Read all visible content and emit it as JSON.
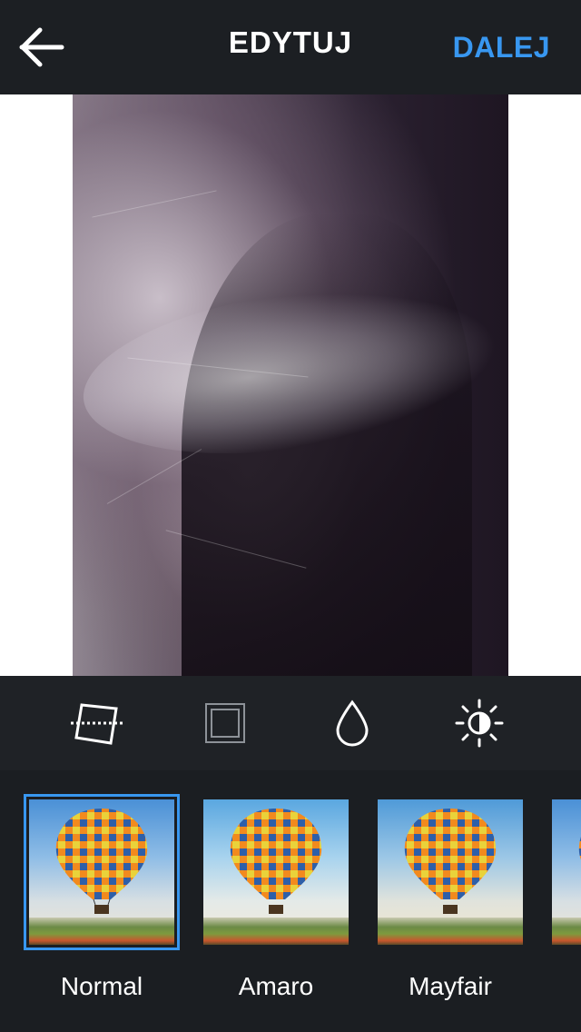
{
  "header": {
    "title": "EDYTUJ",
    "next_label": "DALEJ",
    "back_icon": "arrow-left-icon"
  },
  "tools": [
    {
      "name": "straighten-icon"
    },
    {
      "name": "frame-icon"
    },
    {
      "name": "drop-icon"
    },
    {
      "name": "brightness-icon"
    }
  ],
  "filters": [
    {
      "label": "Normal",
      "selected": true
    },
    {
      "label": "Amaro",
      "selected": false
    },
    {
      "label": "Mayfair",
      "selected": false
    },
    {
      "label": "",
      "selected": false
    }
  ],
  "colors": {
    "accent": "#3897f0",
    "bar_bg": "#1c1f23",
    "panel_bg": "#1b1e22"
  }
}
